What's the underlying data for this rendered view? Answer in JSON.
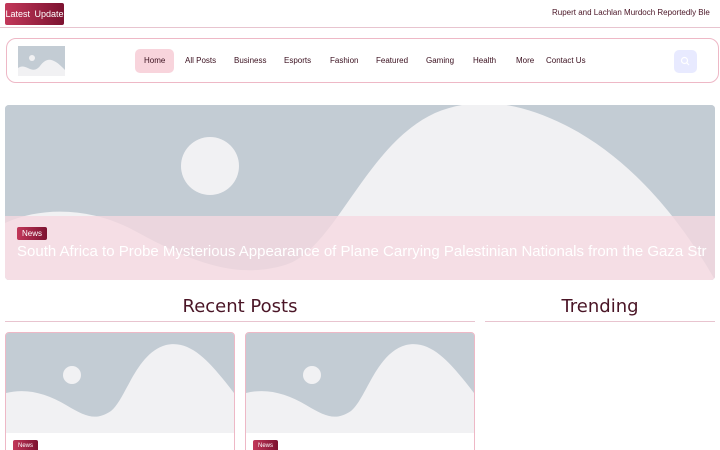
{
  "ticker": {
    "badge": "Latest  Update",
    "headline": "Rupert and Lachlan Murdoch Reportedly Blesse"
  },
  "header": {
    "logo_alt": "image-placeholder-icon",
    "nav": [
      {
        "label": "Home",
        "active": true
      },
      {
        "label": "All Posts"
      },
      {
        "label": "Business"
      },
      {
        "label": "Esports"
      },
      {
        "label": "Fashion"
      },
      {
        "label": "Featured"
      },
      {
        "label": "Gaming"
      },
      {
        "label": "Health"
      },
      {
        "label": "More"
      },
      {
        "label": "Contact Us"
      }
    ],
    "search_icon": "search-icon"
  },
  "hero": {
    "badge": "News",
    "title": "South Africa to Probe Mysterious Appearance of Plane Carrying Palestinian Nationals from the Gaza Strip"
  },
  "sections": {
    "recent": "Recent Posts",
    "trending": "Trending"
  },
  "cards": [
    {
      "badge": "News"
    },
    {
      "badge": "News"
    }
  ],
  "colors": {
    "accent": "#c2385a",
    "accent_dark": "#7c1230",
    "text": "#4a1526",
    "placeholder": "#c3ccd4",
    "border": "#eeb8c6"
  }
}
